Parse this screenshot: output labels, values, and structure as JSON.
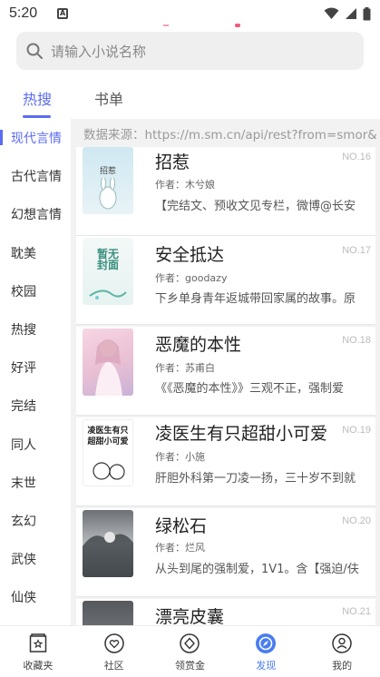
{
  "status": {
    "time": "5:20",
    "notification_icon": "A"
  },
  "search": {
    "placeholder": "请输入小说名称"
  },
  "tabs": [
    {
      "label": "热搜",
      "active": true
    },
    {
      "label": "书单",
      "active": false
    }
  ],
  "sidebar": {
    "items": [
      {
        "label": "现代言情",
        "active": true
      },
      {
        "label": "古代言情"
      },
      {
        "label": "幻想言情"
      },
      {
        "label": "耽美"
      },
      {
        "label": "校园"
      },
      {
        "label": "热搜"
      },
      {
        "label": "好评"
      },
      {
        "label": "完结"
      },
      {
        "label": "同人"
      },
      {
        "label": "末世"
      },
      {
        "label": "玄幻"
      },
      {
        "label": "武侠"
      },
      {
        "label": "仙侠"
      }
    ]
  },
  "content": {
    "source": "数据来源：https://m.sm.cn/api/rest?from=smor&",
    "books": [
      {
        "title": "招惹",
        "no": "NO.16",
        "author": "作者：木兮娘",
        "desc": "【完结文、预收文见专栏，微博@长安",
        "cover_text": "招惹"
      },
      {
        "title": "安全抵达",
        "no": "NO.17",
        "author": "作者：goodazy",
        "desc": "下乡单身青年返城带回家属的故事。原",
        "cover_text": "暂无封面"
      },
      {
        "title": "恶魔的本性",
        "no": "NO.18",
        "author": "作者：苏甫白",
        "desc": "《《恶魔的本性》》三观不正，强制爱",
        "cover_text": ""
      },
      {
        "title": "凌医生有只超甜小可爱",
        "no": "NO.19",
        "author": "作者：小施",
        "desc": "肝胆外科第一刀凌一扬，三十岁不到就",
        "cover_text": "凌医生有只超甜小可爱"
      },
      {
        "title": "绿松石",
        "no": "NO.20",
        "author": "作者：烂风",
        "desc": "从头到尾的强制爱，1V1。含【强迫/伕",
        "cover_text": ""
      },
      {
        "title": "漂亮皮囊",
        "no": "NO.21",
        "author": "",
        "desc": "",
        "cover_text": ""
      }
    ]
  },
  "bottom_nav": [
    {
      "label": "收藏夹",
      "icon": "bookmark-star-icon"
    },
    {
      "label": "社区",
      "icon": "heart-bubble-icon"
    },
    {
      "label": "领赏金",
      "icon": "diamond-coin-icon"
    },
    {
      "label": "发现",
      "icon": "compass-icon",
      "active": true
    },
    {
      "label": "我的",
      "icon": "user-icon"
    }
  ],
  "colors": {
    "accent": "#5b6cf0",
    "nav_active": "#4a7df0"
  }
}
